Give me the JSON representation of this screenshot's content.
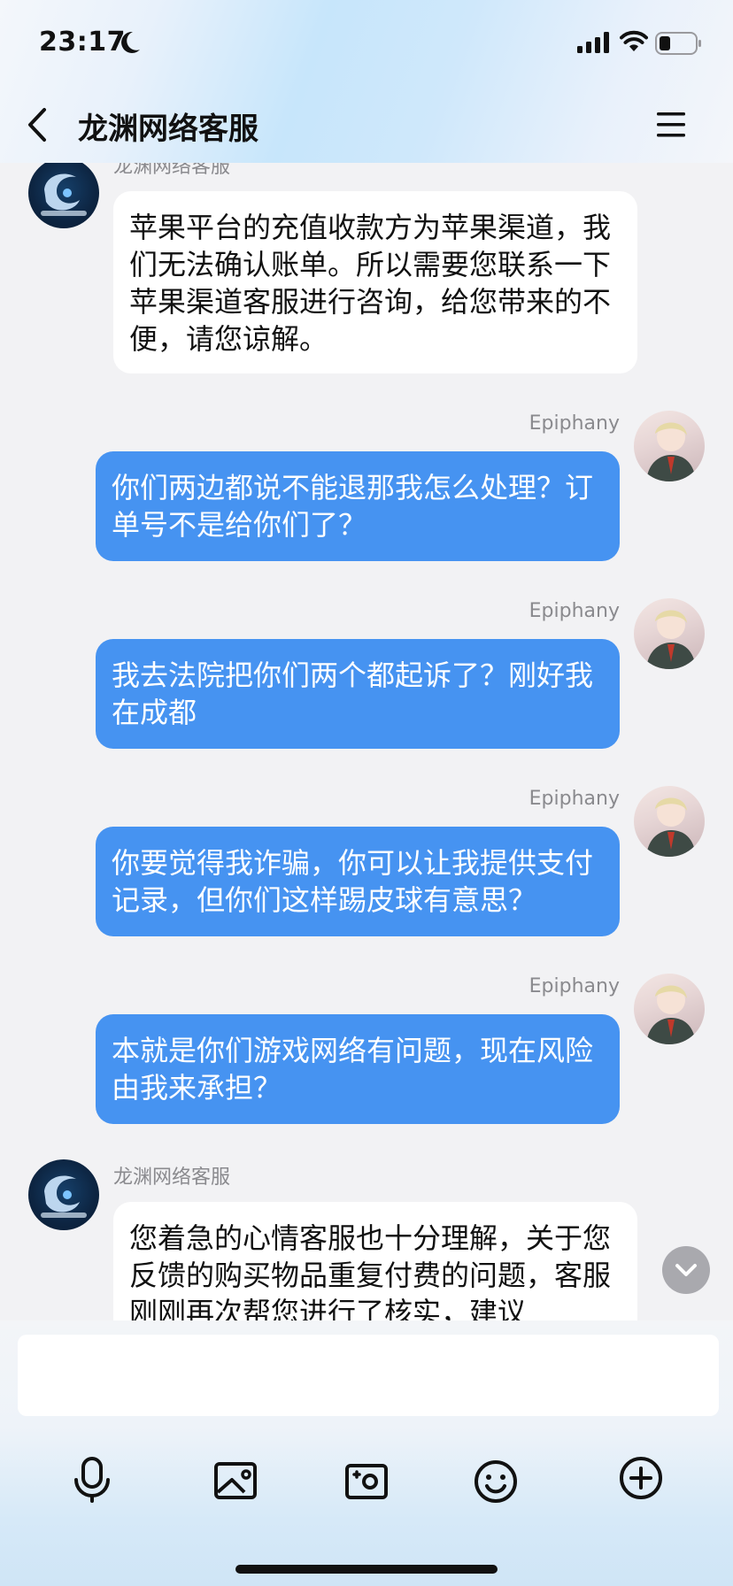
{
  "status": {
    "time": "23:17"
  },
  "header": {
    "title": "龙渊网络客服"
  },
  "messages": [
    {
      "sender": "龙渊网络客服",
      "text": "苹果平台的充值收款方为苹果渠道，我们无法确认账单。所以需要您联系一下苹果渠道客服进行咨询，给您带来的不便，请您谅解。"
    },
    {
      "sender": "Epiphany",
      "text": "你们两边都说不能退那我怎么处理？订单号不是给你们了？"
    },
    {
      "sender": "Epiphany",
      "text": "我去法院把你们两个都起诉了？刚好我在成都"
    },
    {
      "sender": "Epiphany",
      "text": "你要觉得我诈骗，你可以让我提供支付记录，但你们这样踢皮球有意思？"
    },
    {
      "sender": "Epiphany",
      "text": "本就是你们游戏网络有问题，现在风险由我来承担？"
    },
    {
      "sender": "龙渊网络客服",
      "text": "您着急的心情客服也十分理解，关于您反馈的购买物品重复付费的问题，客服刚刚再次帮您进行了核实，建议"
    }
  ],
  "composer": {
    "placeholder": ""
  },
  "icons": [
    "mic-icon",
    "photo-icon",
    "camera-icon",
    "emoji-icon",
    "plus-icon"
  ],
  "colors": {
    "outgoing_bubble": "#4693f1",
    "incoming_bubble": "#ffffff",
    "background": "#f2f2f4"
  }
}
